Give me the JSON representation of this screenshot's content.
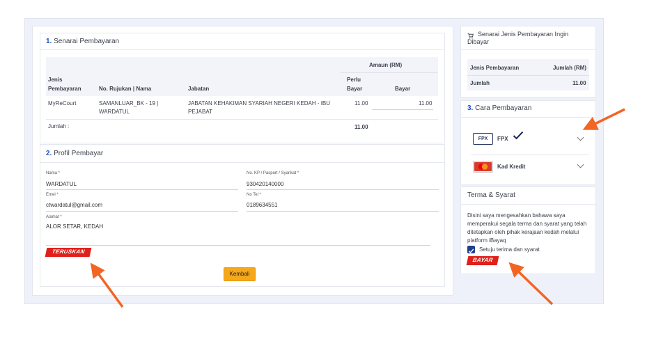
{
  "payment_list": {
    "num": "1.",
    "title": "Senarai Pembayaran",
    "amount_header": "Amaun (RM)",
    "col_type": [
      "Jenis",
      "Pembayaran"
    ],
    "col_ref": "No. Rujukan | Nama",
    "col_dept": "Jabatan",
    "col_due": [
      "Perlu",
      "Bayar"
    ],
    "col_pay": "Bayar",
    "rows": [
      {
        "type": "MyReCourt",
        "ref": [
          "SAMANLUAR_BK - 19 |",
          "WARDATUL"
        ],
        "dept": [
          "JABATAN KEHAKIMAN SYARIAH NEGERI KEDAH - IBU",
          "PEJABAT"
        ],
        "due": "11.00",
        "pay": "11.00"
      }
    ],
    "total_label": "Jumlah :",
    "total_value": "11.00"
  },
  "payer_profile": {
    "num": "2.",
    "title": "Profil Pembayar",
    "name_label": "Nama *",
    "name_value": "WARDATUL",
    "id_label": "No. KP / Pasport / Syarikat *",
    "id_value": "930420140000",
    "email_label": "Emel *",
    "email_value": "ctwardatul@gmail.com",
    "phone_label": "No Tel *",
    "phone_value": "0189634551",
    "address_label": "Alamat *",
    "address_value": "ALOR SETAR, KEDAH",
    "continue_label": "TERUSKAN",
    "back_label": "Kembali"
  },
  "summary": {
    "title": [
      "Senarai Jenis Pembayaran Ingin",
      "Dibayar"
    ],
    "col_type": "Jenis Pembayaran",
    "col_amount": "Jumlah (RM)",
    "total_label": "Jumlah",
    "total_value": "11.00"
  },
  "payment_method": {
    "num": "3.",
    "title": "Cara Pembayaran",
    "fpx_logo": "FPX",
    "fpx_label": "FPX",
    "card_label": "Kad Kredit"
  },
  "terms": {
    "title": "Terma & Syarat",
    "text": [
      "Disini saya mengesahkan bahawa saya",
      "memperakui segala terma dan syarat yang telah",
      "ditetapkan oleh pihak kerajaan kedah melalui",
      "platform iBayaq"
    ],
    "agree_label": "Setuju terima dan syarat",
    "pay_label": "BAYAR"
  },
  "colors": {
    "accent_blue": "#1f4fbf",
    "red_button": "#e0201b",
    "yellow_button": "#f5a81c",
    "arrow": "#f26522"
  }
}
